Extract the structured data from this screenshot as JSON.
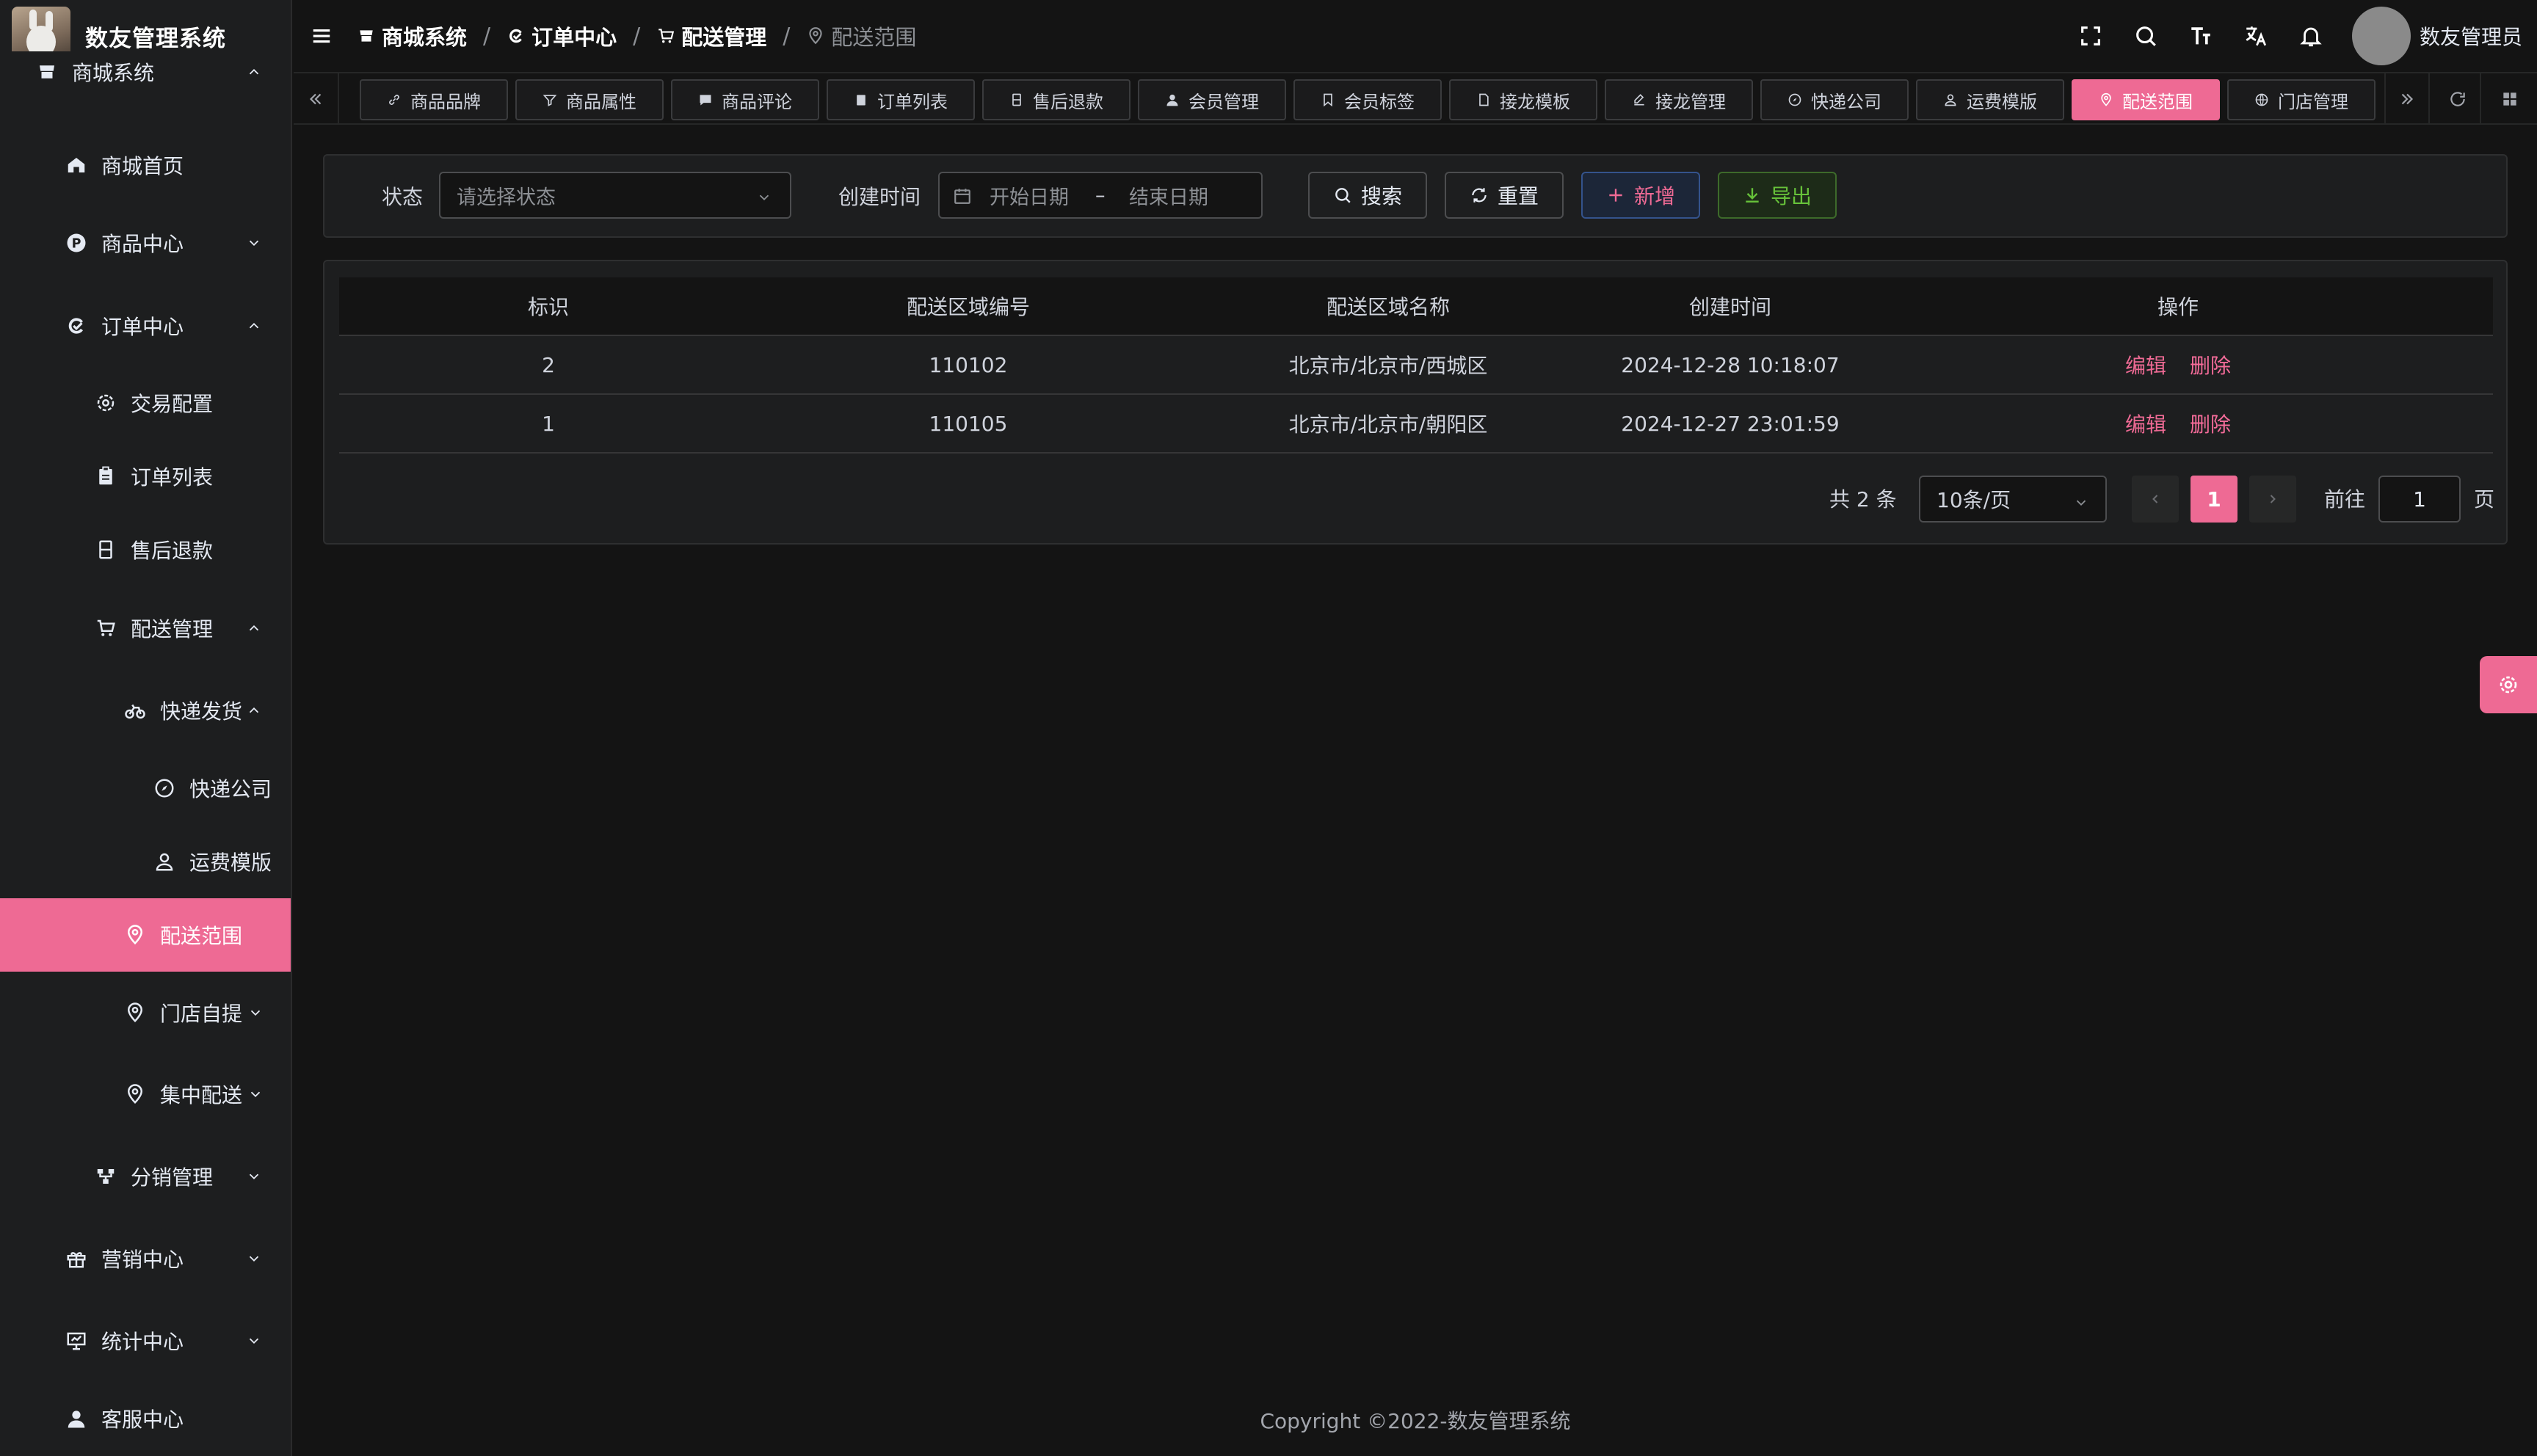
{
  "app": {
    "title": "数友管理系统"
  },
  "sidebar": {
    "items": [
      {
        "label": "商城系统",
        "icon": "shop-icon",
        "arrow": "up"
      },
      {
        "label": "商城首页",
        "icon": "home-icon"
      },
      {
        "label": "商品中心",
        "icon": "product-p-icon",
        "arrow": "down"
      },
      {
        "label": "订单中心",
        "icon": "order-icon",
        "arrow": "up"
      },
      {
        "label": "交易配置",
        "icon": "gear-icon"
      },
      {
        "label": "订单列表",
        "icon": "clipboard-icon"
      },
      {
        "label": "售后退款",
        "icon": "refund-icon"
      },
      {
        "label": "配送管理",
        "icon": "cart-icon",
        "arrow": "up"
      },
      {
        "label": "快递发货",
        "icon": "bike-icon",
        "arrow": "up"
      },
      {
        "label": "快递公司",
        "icon": "compass-icon"
      },
      {
        "label": "运费模版",
        "icon": "user-outline-icon"
      },
      {
        "label": "配送范围",
        "icon": "location-icon",
        "active": true
      },
      {
        "label": "门店自提",
        "icon": "location-icon",
        "arrow": "down"
      },
      {
        "label": "集中配送",
        "icon": "location-icon",
        "arrow": "down"
      },
      {
        "label": "分销管理",
        "icon": "share-icon",
        "arrow": "down"
      },
      {
        "label": "营销中心",
        "icon": "gift-icon",
        "arrow": "down"
      },
      {
        "label": "统计中心",
        "icon": "presentation-icon",
        "arrow": "down"
      },
      {
        "label": "客服中心",
        "icon": "user-icon"
      }
    ]
  },
  "header": {
    "breadcrumb": [
      {
        "label": "商城系统",
        "icon": "shop-icon"
      },
      {
        "label": "订单中心",
        "icon": "order-icon"
      },
      {
        "label": "配送管理",
        "icon": "cart-icon"
      },
      {
        "label": "配送范围",
        "icon": "location-icon"
      }
    ],
    "user_name": "数友管理员"
  },
  "tags": [
    {
      "label": "商品品牌",
      "icon": "link-icon"
    },
    {
      "label": "商品属性",
      "icon": "filter-icon"
    },
    {
      "label": "商品评论",
      "icon": "comment-icon"
    },
    {
      "label": "订单列表",
      "icon": "clipboard-icon"
    },
    {
      "label": "售后退款",
      "icon": "refund-icon"
    },
    {
      "label": "会员管理",
      "icon": "user-icon"
    },
    {
      "label": "会员标签",
      "icon": "bookmark-icon"
    },
    {
      "label": "接龙模板",
      "icon": "document-icon"
    },
    {
      "label": "接龙管理",
      "icon": "edit-icon"
    },
    {
      "label": "快递公司",
      "icon": "compass-icon"
    },
    {
      "label": "运费模版",
      "icon": "user-outline-icon"
    },
    {
      "label": "配送范围",
      "icon": "location-icon",
      "active": true
    },
    {
      "label": "门店管理",
      "icon": "globe-icon"
    }
  ],
  "search": {
    "status_label": "状态",
    "status_placeholder": "请选择状态",
    "created_label": "创建时间",
    "start_placeholder": "开始日期",
    "range_sep": "–",
    "end_placeholder": "结束日期",
    "search_btn": "搜索",
    "reset_btn": "重置",
    "add_btn": "新增",
    "export_btn": "导出"
  },
  "table": {
    "columns": [
      "标识",
      "配送区域编号",
      "配送区域名称",
      "创建时间",
      "操作"
    ],
    "rows": [
      {
        "id": "2",
        "code": "110102",
        "name": "北京市/北京市/西城区",
        "created": "2024-12-28 10:18:07"
      },
      {
        "id": "1",
        "code": "110105",
        "name": "北京市/北京市/朝阳区",
        "created": "2024-12-27 23:01:59"
      }
    ],
    "edit_label": "编辑",
    "delete_label": "删除"
  },
  "pagination": {
    "total_text": "共 2 条",
    "page_size": "10条/页",
    "current_page": "1",
    "goto_label": "前往",
    "goto_value": "1",
    "page_unit": "页"
  },
  "footer": {
    "copyright": "Copyright ©2022-数友管理系统"
  },
  "colors": {
    "accent": "#ee6a94",
    "success": "#67c23a",
    "bg": "#141414",
    "panel": "#1d1e1f"
  }
}
